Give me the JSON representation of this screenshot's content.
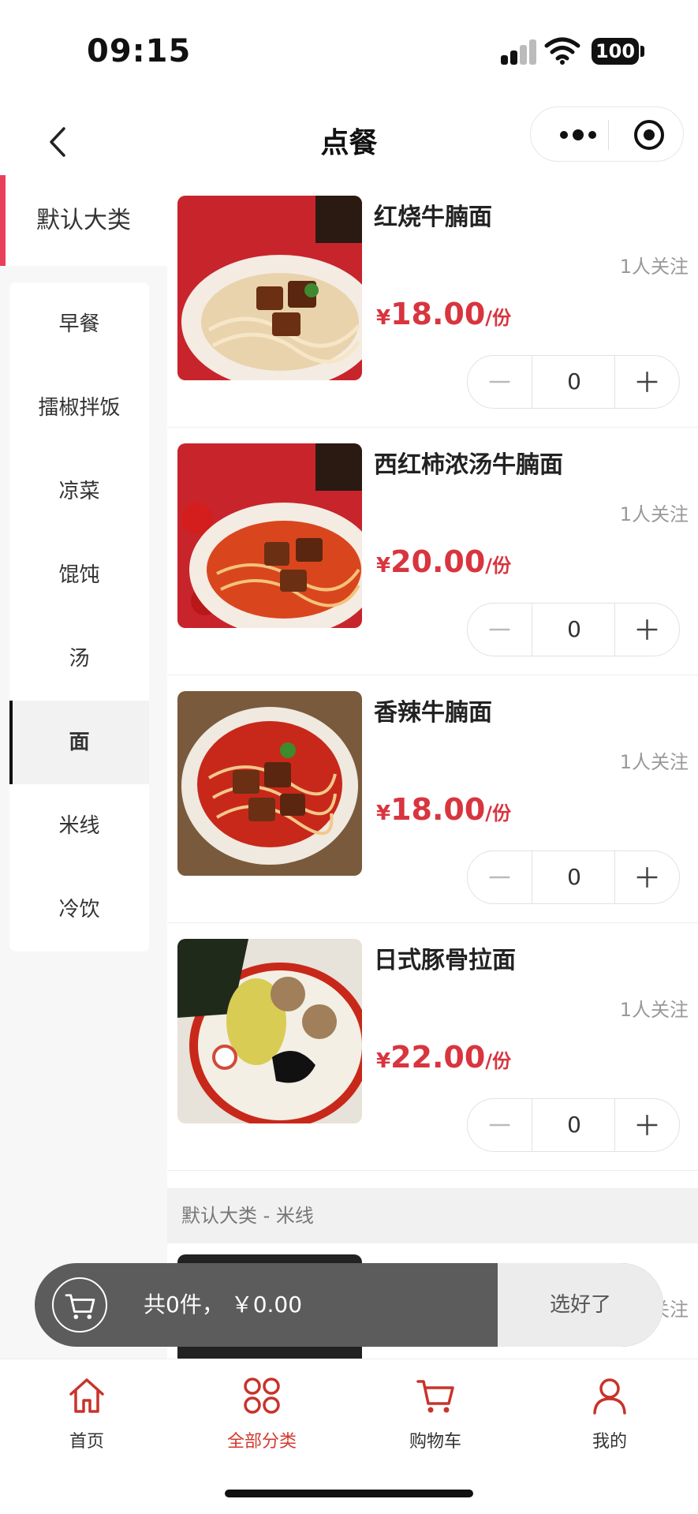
{
  "status_bar": {
    "time": "09:15",
    "battery": "100"
  },
  "nav": {
    "title": "点餐"
  },
  "sidebar": {
    "category": "默认大类",
    "items": [
      {
        "label": "早餐"
      },
      {
        "label": "擂椒拌饭"
      },
      {
        "label": "凉菜"
      },
      {
        "label": "馄饨"
      },
      {
        "label": "汤"
      },
      {
        "label": "面",
        "active": true
      },
      {
        "label": "米线"
      },
      {
        "label": "冷饮"
      }
    ]
  },
  "products": [
    {
      "name": "红烧牛腩面",
      "followers": "1人关注",
      "currency": "¥",
      "price": "18.00",
      "unit": "/份",
      "qty": "0"
    },
    {
      "name": "西红柿浓汤牛腩面",
      "followers": "1人关注",
      "currency": "¥",
      "price": "20.00",
      "unit": "/份",
      "qty": "0"
    },
    {
      "name": "香辣牛腩面",
      "followers": "1人关注",
      "currency": "¥",
      "price": "18.00",
      "unit": "/份",
      "qty": "0"
    },
    {
      "name": "日式豚骨拉面",
      "followers": "1人关注",
      "currency": "¥",
      "price": "22.00",
      "unit": "/份",
      "qty": "0"
    }
  ],
  "section": {
    "label": "默认大类 - 米线"
  },
  "partial_product": {
    "followers": "关注"
  },
  "cart": {
    "summary": "共0件， ￥0.00",
    "confirm": "选好了"
  },
  "tabs": [
    {
      "label": "首页"
    },
    {
      "label": "全部分类",
      "active": true
    },
    {
      "label": "购物车"
    },
    {
      "label": "我的"
    }
  ],
  "colors": {
    "accent": "#d8353f",
    "category_marker": "#e8405a",
    "tab_active": "#d33a2f"
  }
}
